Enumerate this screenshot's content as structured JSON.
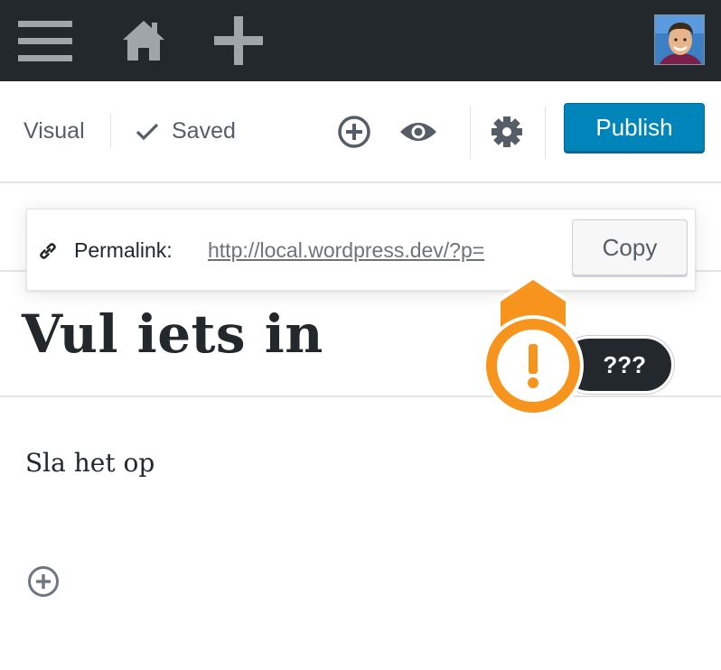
{
  "adminbar": {
    "menu_icon": "hamburger-menu-icon",
    "home_icon": "home-icon",
    "new_icon": "plus-icon",
    "avatar": "user-avatar"
  },
  "toolbar": {
    "mode_label": "Visual",
    "saved_label": "Saved",
    "saved_icon": "checkmark-icon",
    "insert_icon": "plus-circle-icon",
    "preview_icon": "eye-icon",
    "settings_icon": "gear-icon",
    "publish_label": "Publish"
  },
  "permalink": {
    "icon": "link-icon",
    "label": "Permalink:",
    "url": "http://local.wordpress.dev/?p=",
    "copy_label": "Copy"
  },
  "post": {
    "title": "Vul iets in",
    "paragraph": "Sla het op"
  },
  "annotation": {
    "warning_icon": "exclamation-icon",
    "badge_text": "???",
    "warning_color": "#f7941d"
  },
  "colors": {
    "adminbar_bg": "#23282d",
    "publish_bg": "#0085ba"
  }
}
